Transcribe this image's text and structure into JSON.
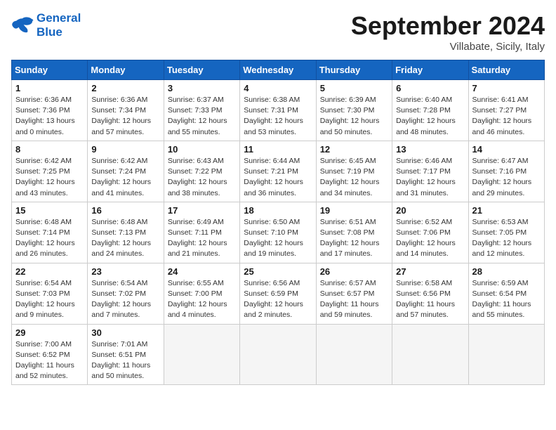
{
  "header": {
    "logo_line1": "General",
    "logo_line2": "Blue",
    "month": "September 2024",
    "location": "Villabate, Sicily, Italy"
  },
  "weekdays": [
    "Sunday",
    "Monday",
    "Tuesday",
    "Wednesday",
    "Thursday",
    "Friday",
    "Saturday"
  ],
  "weeks": [
    [
      {
        "day": "1",
        "info": "Sunrise: 6:36 AM\nSunset: 7:36 PM\nDaylight: 13 hours\nand 0 minutes."
      },
      {
        "day": "2",
        "info": "Sunrise: 6:36 AM\nSunset: 7:34 PM\nDaylight: 12 hours\nand 57 minutes."
      },
      {
        "day": "3",
        "info": "Sunrise: 6:37 AM\nSunset: 7:33 PM\nDaylight: 12 hours\nand 55 minutes."
      },
      {
        "day": "4",
        "info": "Sunrise: 6:38 AM\nSunset: 7:31 PM\nDaylight: 12 hours\nand 53 minutes."
      },
      {
        "day": "5",
        "info": "Sunrise: 6:39 AM\nSunset: 7:30 PM\nDaylight: 12 hours\nand 50 minutes."
      },
      {
        "day": "6",
        "info": "Sunrise: 6:40 AM\nSunset: 7:28 PM\nDaylight: 12 hours\nand 48 minutes."
      },
      {
        "day": "7",
        "info": "Sunrise: 6:41 AM\nSunset: 7:27 PM\nDaylight: 12 hours\nand 46 minutes."
      }
    ],
    [
      {
        "day": "8",
        "info": "Sunrise: 6:42 AM\nSunset: 7:25 PM\nDaylight: 12 hours\nand 43 minutes."
      },
      {
        "day": "9",
        "info": "Sunrise: 6:42 AM\nSunset: 7:24 PM\nDaylight: 12 hours\nand 41 minutes."
      },
      {
        "day": "10",
        "info": "Sunrise: 6:43 AM\nSunset: 7:22 PM\nDaylight: 12 hours\nand 38 minutes."
      },
      {
        "day": "11",
        "info": "Sunrise: 6:44 AM\nSunset: 7:21 PM\nDaylight: 12 hours\nand 36 minutes."
      },
      {
        "day": "12",
        "info": "Sunrise: 6:45 AM\nSunset: 7:19 PM\nDaylight: 12 hours\nand 34 minutes."
      },
      {
        "day": "13",
        "info": "Sunrise: 6:46 AM\nSunset: 7:17 PM\nDaylight: 12 hours\nand 31 minutes."
      },
      {
        "day": "14",
        "info": "Sunrise: 6:47 AM\nSunset: 7:16 PM\nDaylight: 12 hours\nand 29 minutes."
      }
    ],
    [
      {
        "day": "15",
        "info": "Sunrise: 6:48 AM\nSunset: 7:14 PM\nDaylight: 12 hours\nand 26 minutes."
      },
      {
        "day": "16",
        "info": "Sunrise: 6:48 AM\nSunset: 7:13 PM\nDaylight: 12 hours\nand 24 minutes."
      },
      {
        "day": "17",
        "info": "Sunrise: 6:49 AM\nSunset: 7:11 PM\nDaylight: 12 hours\nand 21 minutes."
      },
      {
        "day": "18",
        "info": "Sunrise: 6:50 AM\nSunset: 7:10 PM\nDaylight: 12 hours\nand 19 minutes."
      },
      {
        "day": "19",
        "info": "Sunrise: 6:51 AM\nSunset: 7:08 PM\nDaylight: 12 hours\nand 17 minutes."
      },
      {
        "day": "20",
        "info": "Sunrise: 6:52 AM\nSunset: 7:06 PM\nDaylight: 12 hours\nand 14 minutes."
      },
      {
        "day": "21",
        "info": "Sunrise: 6:53 AM\nSunset: 7:05 PM\nDaylight: 12 hours\nand 12 minutes."
      }
    ],
    [
      {
        "day": "22",
        "info": "Sunrise: 6:54 AM\nSunset: 7:03 PM\nDaylight: 12 hours\nand 9 minutes."
      },
      {
        "day": "23",
        "info": "Sunrise: 6:54 AM\nSunset: 7:02 PM\nDaylight: 12 hours\nand 7 minutes."
      },
      {
        "day": "24",
        "info": "Sunrise: 6:55 AM\nSunset: 7:00 PM\nDaylight: 12 hours\nand 4 minutes."
      },
      {
        "day": "25",
        "info": "Sunrise: 6:56 AM\nSunset: 6:59 PM\nDaylight: 12 hours\nand 2 minutes."
      },
      {
        "day": "26",
        "info": "Sunrise: 6:57 AM\nSunset: 6:57 PM\nDaylight: 11 hours\nand 59 minutes."
      },
      {
        "day": "27",
        "info": "Sunrise: 6:58 AM\nSunset: 6:56 PM\nDaylight: 11 hours\nand 57 minutes."
      },
      {
        "day": "28",
        "info": "Sunrise: 6:59 AM\nSunset: 6:54 PM\nDaylight: 11 hours\nand 55 minutes."
      }
    ],
    [
      {
        "day": "29",
        "info": "Sunrise: 7:00 AM\nSunset: 6:52 PM\nDaylight: 11 hours\nand 52 minutes."
      },
      {
        "day": "30",
        "info": "Sunrise: 7:01 AM\nSunset: 6:51 PM\nDaylight: 11 hours\nand 50 minutes."
      },
      {
        "day": "",
        "info": ""
      },
      {
        "day": "",
        "info": ""
      },
      {
        "day": "",
        "info": ""
      },
      {
        "day": "",
        "info": ""
      },
      {
        "day": "",
        "info": ""
      }
    ]
  ]
}
